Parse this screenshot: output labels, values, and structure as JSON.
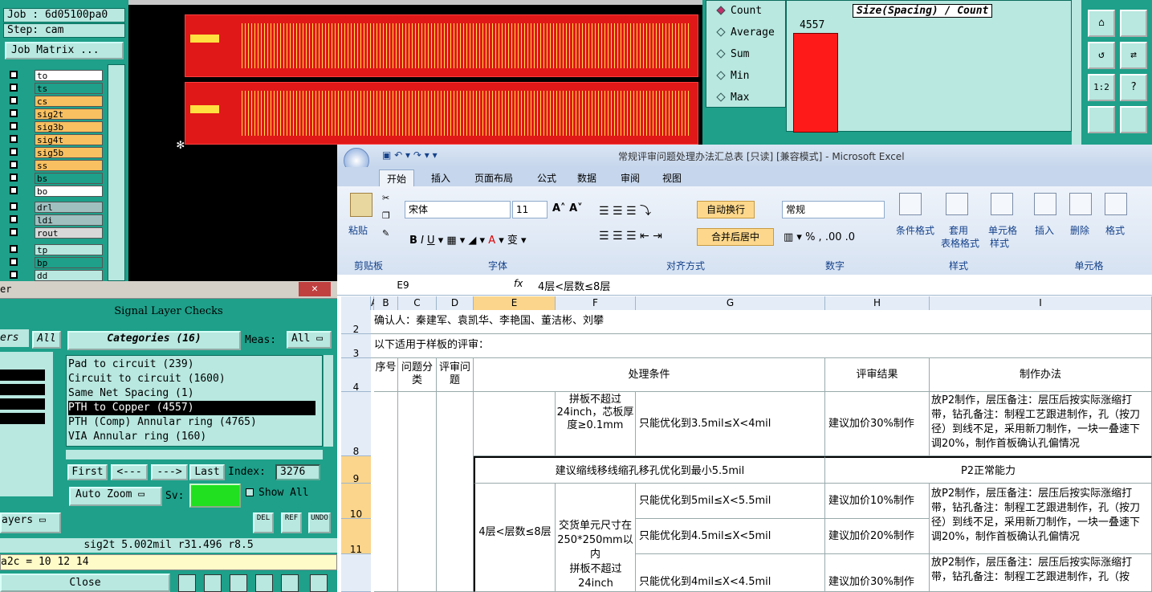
{
  "left_panel": {
    "job": "Job : 6d05100pa0",
    "step": "Step: cam",
    "job_matrix": "Job Matrix ...",
    "layers": [
      {
        "name": "to",
        "color": "#ffffff"
      },
      {
        "name": "ts",
        "color": "#1ea08a"
      },
      {
        "name": "cs",
        "color": "#f8c060"
      },
      {
        "name": "sig2t",
        "color": "#f8c060"
      },
      {
        "name": "sig3b",
        "color": "#f8c060"
      },
      {
        "name": "sig4t",
        "color": "#f8c060"
      },
      {
        "name": "sig5b",
        "color": "#f8c060"
      },
      {
        "name": "ss",
        "color": "#f8c060"
      },
      {
        "name": "bs",
        "color": "#1ea08a"
      },
      {
        "name": "bo",
        "color": "#ffffff"
      },
      {
        "name": "drl",
        "color": "#a0c0c0"
      },
      {
        "name": "ldi",
        "color": "#a0c0c0"
      },
      {
        "name": "rout",
        "color": "#d8d8d8"
      },
      {
        "name": "tp",
        "color": "#b8e8e0"
      },
      {
        "name": "bp",
        "color": "#1ea08a"
      },
      {
        "name": "dd",
        "color": "#b8e8e0"
      }
    ]
  },
  "histogram": {
    "options": [
      "Count",
      "Average",
      "Sum",
      "Min",
      "Max"
    ],
    "title": "Size(Spacing) / Count",
    "bar_value": "4557"
  },
  "signal_checks": {
    "window_title_partial": "er",
    "title": "Signal Layer Checks",
    "layers_label": "ers",
    "all": "All",
    "categories": "Categories (16)",
    "meas_label": "Meas:",
    "meas_value": "All",
    "items": [
      "Pad to circuit (239)",
      "Circuit to circuit (1600)",
      "Same Net Spacing (1)",
      "PTH to Copper (4557)",
      "PTH (Comp) Annular ring (4765)",
      "VIA Annular ring (160)"
    ],
    "first": "First",
    "prev": "<---",
    "next": "--->",
    "last": "Last",
    "index_label": "Index:",
    "index_value": "3276",
    "auto_zoom": "Auto Zoom",
    "sv": "Sv:",
    "show_all": "Show All",
    "layers_btn": "ayers",
    "del": "DEL",
    "ref": "REF",
    "undo": "UNDO",
    "status": "sig2t 5.002mil   r31.496  r8.5",
    "cmd": "a2c = 10 12 14",
    "close": "Close"
  },
  "excel": {
    "title": "常规评审问题处理办法汇总表 [只读] [兼容模式] - Microsoft Excel",
    "tabs": [
      "开始",
      "插入",
      "页面布局",
      "公式",
      "数据",
      "审阅",
      "视图"
    ],
    "font_name": "宋体",
    "font_size": "11",
    "number_format": "常规",
    "wrap": "自动换行",
    "merge": "合并后居中",
    "paste": "粘贴",
    "cond_format": "条件格式",
    "table_format": "套用",
    "table_format2": "表格格式",
    "cell_style": "单元格",
    "cell_style2": "样式",
    "insert": "插入",
    "delete": "删除",
    "format": "格式",
    "groups": [
      "剪贴板",
      "字体",
      "对齐方式",
      "数字",
      "样式",
      "单元格"
    ],
    "name_box": "E9",
    "formula": "4层<层数≤8层",
    "columns": [
      "A",
      "B",
      "C",
      "D",
      "E",
      "F",
      "G",
      "H",
      "I"
    ],
    "rows": {
      "r2": "确认人：秦建军、袁凯华、李艳国、董洁彬、刘攀",
      "r3": "以下适用于样板的评审：",
      "h_seq": "序号",
      "h_cat": "问题分类",
      "h_issue": "评审问题",
      "h_cond": "处理条件",
      "h_result": "评审结果",
      "h_method": "制作办法",
      "r8_f": "拼板不超过24inch，芯板厚度≥0.1mm",
      "r8_g": "只能优化到3.5mil≤X<4mil",
      "r8_h": "建议加价30%制作",
      "r8_i": "放P2制作，层压备注：层压后按实际涨缩打带，钻孔备注：制程工艺跟进制作，孔（按刀径）到线不足，采用新刀制作，一块一叠速下调20%，制作首板确认孔偏情况",
      "r9_ef": "建议缩线移线缩孔移孔优化到最小5.5mil",
      "r9_hi": "P2正常能力",
      "e_merge": "4层<层数≤8层",
      "f_merge": "交货单元尺寸在250*250mm以内",
      "f_merge2": "拼板不超过24inch",
      "r10_g": "只能优化到5mil≤X<5.5mil",
      "r10_h": "建议加价10%制作",
      "r11_g": "只能优化到4.5mil≤X<5mil",
      "r11_h": "建议加价20%制作",
      "r10_i": "放P2制作，层压备注：层压后按实际涨缩打带，钻孔备注：制程工艺跟进制作，孔（按刀径）到线不足，采用新刀制作，一块一叠速下调20%，制作首板确认孔偏情况",
      "r12_g": "只能优化到4mil≤X<4.5mil",
      "r12_h": "建议加价30%制作",
      "r12_i": "放P2制作，层压备注：层压后按实际涨缩打带，钻孔备注：制程工艺跟进制作，孔（按"
    },
    "row_nums": [
      "2",
      "3",
      "4",
      "8",
      "9",
      "10",
      "11"
    ]
  }
}
